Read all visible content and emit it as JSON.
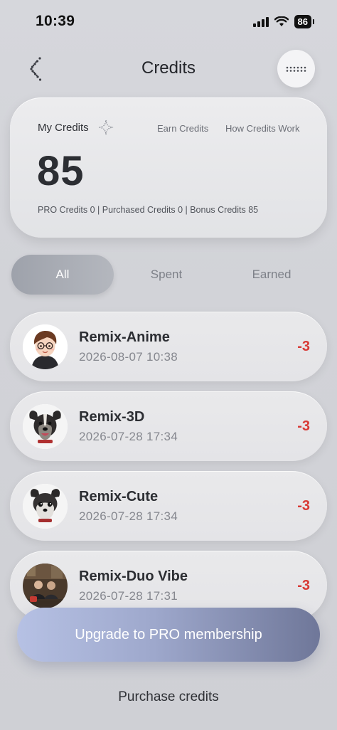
{
  "status_bar": {
    "time": "10:39",
    "battery": "86"
  },
  "nav": {
    "title": "Credits"
  },
  "credits_card": {
    "label": "My Credits",
    "earn_link": "Earn Credits",
    "how_link": "How Credits Work",
    "value": "85",
    "breakdown": "PRO Credits 0 |  Purchased Credits 0 | Bonus Credits 85"
  },
  "tabs": [
    {
      "label": "All",
      "active": true
    },
    {
      "label": "Spent",
      "active": false
    },
    {
      "label": "Earned",
      "active": false
    }
  ],
  "history": [
    {
      "title": "Remix-Anime",
      "date": "2026-08-07 10:38",
      "amount": "-3",
      "avatar": "anime-avatar-icon"
    },
    {
      "title": "Remix-3D",
      "date": "2026-07-28 17:34",
      "amount": "-3",
      "avatar": "dog-3d-avatar-icon"
    },
    {
      "title": "Remix-Cute",
      "date": "2026-07-28 17:34",
      "amount": "-3",
      "avatar": "dog-cute-avatar-icon"
    },
    {
      "title": "Remix-Duo Vibe",
      "date": "2026-07-28 17:31",
      "amount": "-3",
      "avatar": "duo-photo-avatar-icon"
    }
  ],
  "actions": {
    "upgrade": "Upgrade to PRO membership",
    "purchase": "Purchase credits"
  },
  "colors": {
    "negative_amount": "#d83a35",
    "upgrade_gradient_start": "#b6c1e4",
    "upgrade_gradient_end": "#6f7799"
  }
}
